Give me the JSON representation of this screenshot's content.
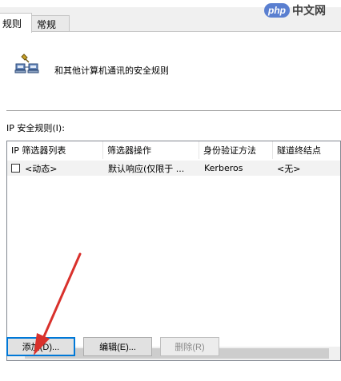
{
  "tabs": [
    {
      "label": "规则",
      "active": true
    },
    {
      "label": "常规",
      "active": false
    }
  ],
  "header": {
    "text": "和其他计算机通讯的安全规则",
    "icon": "network-computers-icon"
  },
  "rules_label": "IP 安全规则(I):",
  "table": {
    "columns": [
      "IP 筛选器列表",
      "筛选器操作",
      "身份验证方法",
      "隧道终结点"
    ],
    "rows": [
      {
        "checked": false,
        "filter_list": "<动态>",
        "filter_action": "默认响应(仅限于 ...",
        "auth_method": "Kerberos",
        "tunnel_endpoint": "<无>"
      }
    ]
  },
  "scrollbar": {
    "left_arrow": "<"
  },
  "buttons": {
    "add": "添加(D)...",
    "edit": "编辑(E)...",
    "remove": "删除(R)"
  },
  "watermark": {
    "badge": "php",
    "text": "中文网"
  },
  "colors": {
    "accent_focus": "#0078d7",
    "arrow_red": "#d9312c",
    "watermark_blue": "#5a7fd0"
  }
}
